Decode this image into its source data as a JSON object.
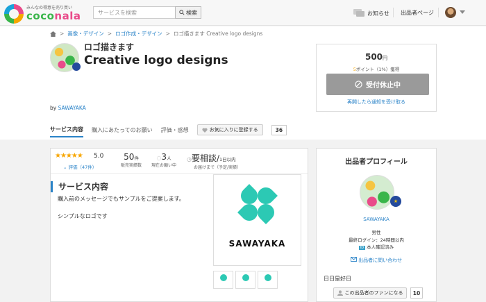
{
  "header": {
    "logo_tagline": "みんなの得意を売り買い",
    "logo_word_main": "coco",
    "logo_word_accent": "nala",
    "search_placeholder": "サービスを検索",
    "search_button": "検索",
    "notifications": "お知らせ",
    "seller_page": "出品者ページ"
  },
  "breadcrumb": {
    "home_icon": "home-icon",
    "items": [
      "画像・デザイン",
      "ロゴ作成・デザイン",
      "ロゴ描きます Creative logo designs"
    ],
    "separator": ">"
  },
  "service": {
    "subtitle": "ロゴ描きます",
    "title": "Creative logo designs",
    "by_prefix": "by",
    "seller": "SAWAYAKA"
  },
  "tabs": {
    "items": [
      "サービス内容",
      "購入にあたってのお願い",
      "評価・感想"
    ],
    "favorite_button": "お気に入りに登録する",
    "favorite_count": "36"
  },
  "pricebox": {
    "price": "500",
    "price_unit": "円",
    "points_value": "5",
    "points_text": "ポイント（1%）獲得",
    "closed_button": "受付休止中",
    "notify_link": "再開したら通知を受け取る"
  },
  "stats": {
    "stars": "★★★★★",
    "rating": "5.0",
    "reviews": "評価（47件）",
    "sales_num": "50",
    "sales_unit": "件",
    "sales_label": "販売実績数",
    "pending_num": "3",
    "pending_unit": "人",
    "pending_label": "現在お願い中",
    "delivery_num": "要相談",
    "delivery_slash": "/",
    "delivery_sub": "1日以内",
    "delivery_label": "お届けまで（予定/実績）"
  },
  "content": {
    "section_title": "サービス内容",
    "desc_line1": "購入前のメッセージでもサンプルをご提案します。",
    "desc_line2": "シンプルなロゴです",
    "gallery_word": "SAWAYAKA"
  },
  "seller": {
    "title": "出品者プロフィール",
    "badge": "★",
    "name": "SAWAYAKA",
    "gender": "男性",
    "last_login": "最終ログイン：24時間以内",
    "verified_tag": "ID",
    "verified": "本人確認済み",
    "contact": "出品者に問い合わせ",
    "holiday": "日日是好日",
    "fan_button": "この出品者のファンになる",
    "fan_count": "10"
  },
  "colors": {
    "accent": "#2a83c8",
    "star": "#f7a600",
    "closed": "#9a9a9a",
    "clover": "#2cc9b4"
  }
}
